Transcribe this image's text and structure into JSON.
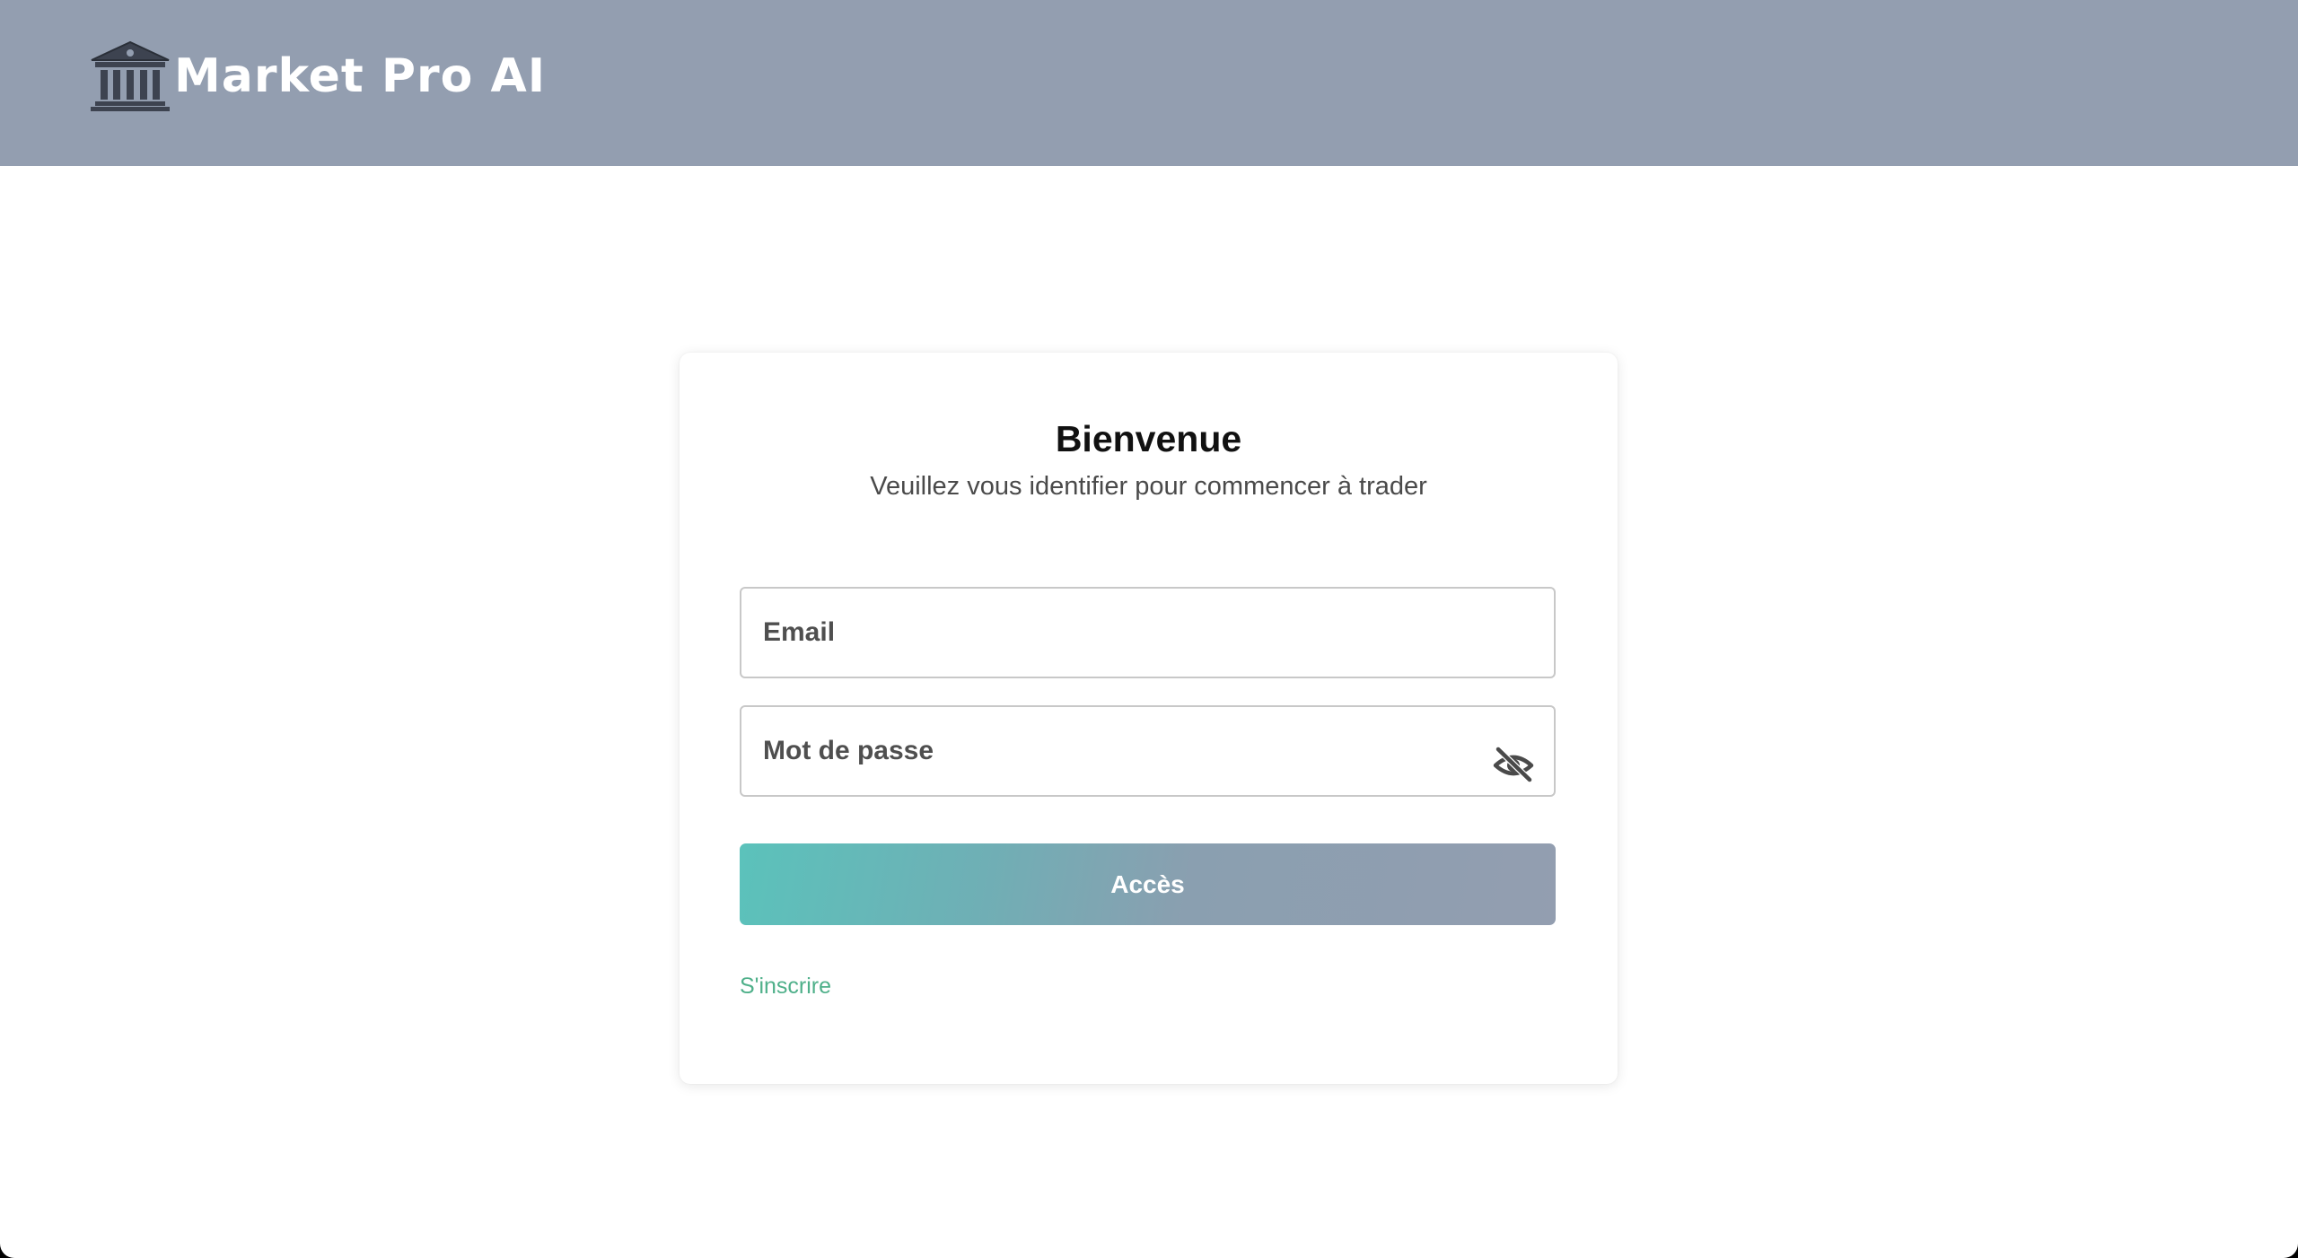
{
  "header": {
    "brand_name": "Market Pro AI",
    "logo_icon": "bank-building-icon"
  },
  "login": {
    "title": "Bienvenue",
    "subtitle": "Veuillez vous identifier pour commencer à trader",
    "email": {
      "placeholder": "Email",
      "value": ""
    },
    "password": {
      "placeholder": "Mot de passe",
      "value": "",
      "toggle_icon": "eye-off-icon"
    },
    "submit_label": "Accès",
    "signup_link": "S'inscrire"
  },
  "colors": {
    "header_bg": "#939eb0",
    "accent_teal": "#5bc2bb",
    "link_green": "#4fb08a",
    "card_bg": "#ffffff"
  }
}
